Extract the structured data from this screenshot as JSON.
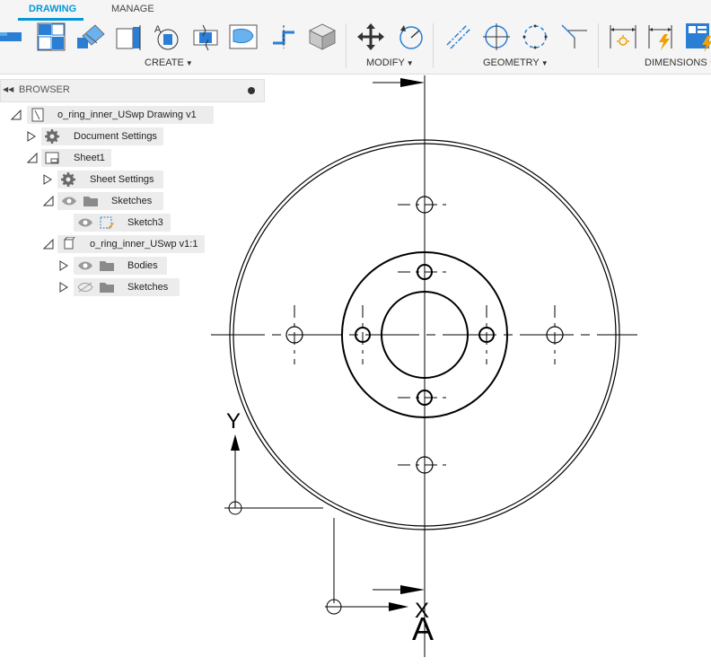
{
  "tabs": [
    {
      "label": "DRAWING",
      "active": true
    },
    {
      "label": "MANAGE",
      "active": false
    }
  ],
  "groups": {
    "create": "CREATE",
    "modify": "MODIFY",
    "geometry": "GEOMETRY",
    "dimensions": "DIMENSIONS"
  },
  "browser": {
    "title": "BROWSER",
    "items": [
      {
        "label": "o_ring_inner_USwp Drawing v1"
      },
      {
        "label": "Document Settings"
      },
      {
        "label": "Sheet1"
      },
      {
        "label": "Sheet Settings"
      },
      {
        "label": "Sketches"
      },
      {
        "label": "Sketch3"
      },
      {
        "label": "o_ring_inner_USwp v1:1"
      },
      {
        "label": "Bodies"
      },
      {
        "label": "Sketches"
      }
    ]
  },
  "canvas": {
    "y_axis_label": "Y",
    "x_axis_label": "X",
    "view_label": "A"
  },
  "colors": {
    "accent": "#0696d7",
    "folder": "#8a8a8a",
    "gear": "#6a6a6a",
    "dim_icon_orange": "#f0a000"
  }
}
